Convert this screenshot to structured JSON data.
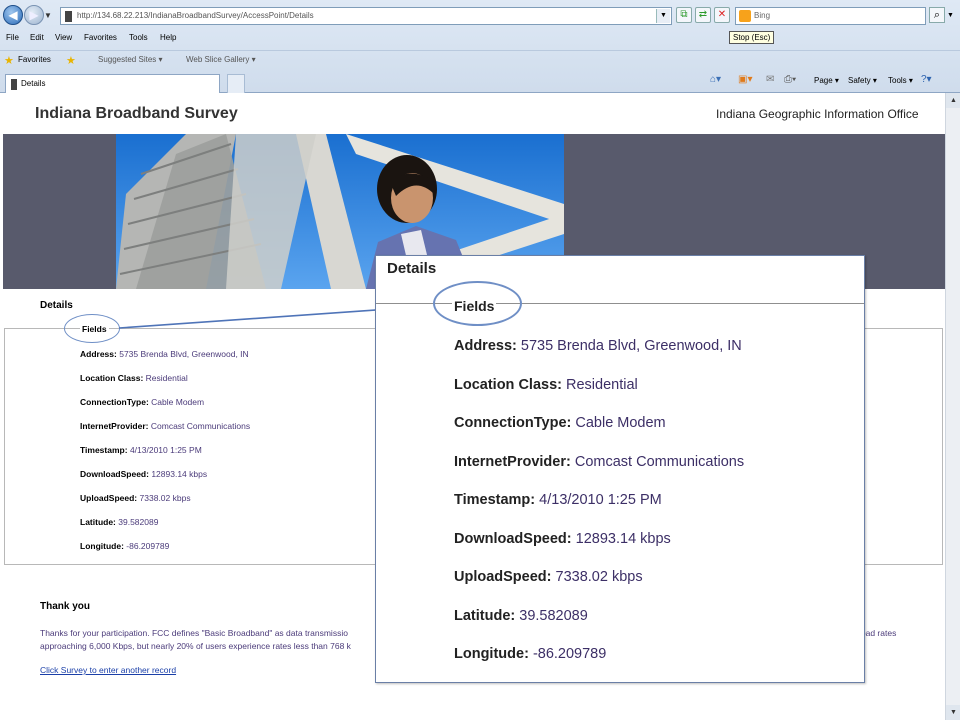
{
  "browser": {
    "address": "http://134.68.22.213/IndianaBroadbandSurvey/AccessPoint/Details",
    "search_placeholder": "Bing",
    "tooltip": "Stop (Esc)",
    "menu": [
      "File",
      "Edit",
      "View",
      "Favorites",
      "Tools",
      "Help"
    ],
    "favorites_label": "Favorites",
    "fav_links": [
      "Suggested Sites ▾",
      "Web Slice Gallery ▾"
    ],
    "tab_title": "Details",
    "tools": [
      "Page ▾",
      "Safety ▾",
      "Tools ▾"
    ]
  },
  "header": {
    "site_title": "Indiana Broadband Survey",
    "office": "Indiana Geographic Information Office"
  },
  "details": {
    "heading": "Details",
    "fields_legend": "Fields",
    "rows": [
      {
        "key": "Address:",
        "value": "5735 Brenda Blvd, Greenwood, IN"
      },
      {
        "key": "Location Class:",
        "value": "Residential"
      },
      {
        "key": "ConnectionType:",
        "value": "Cable Modem"
      },
      {
        "key": "InternetProvider:",
        "value": "Comcast Communications"
      },
      {
        "key": "Timestamp:",
        "value": "4/13/2010 1:25 PM"
      },
      {
        "key": "DownloadSpeed:",
        "value": "12893.14 kbps"
      },
      {
        "key": "UploadSpeed:",
        "value": "7338.02 kbps"
      },
      {
        "key": "Latitude:",
        "value": "39.582089"
      },
      {
        "key": "Longitude:",
        "value": "-86.209789"
      }
    ]
  },
  "thanks": {
    "heading": "Thank you",
    "text_line1_left": "Thanks for your participation. FCC defines \"Basic Broadband\" as data transmissio",
    "text_line1_right": "load rates",
    "text_line2": "approaching 6,000 Kbps, but nearly 20% of users experience rates less than 768 k",
    "link": "Click Survey to enter another record"
  },
  "colors": {
    "banner_gray": "#585a6c",
    "value_text": "#4b3b7a",
    "link": "#1a3fa8",
    "annotation": "#6f8fc6"
  }
}
